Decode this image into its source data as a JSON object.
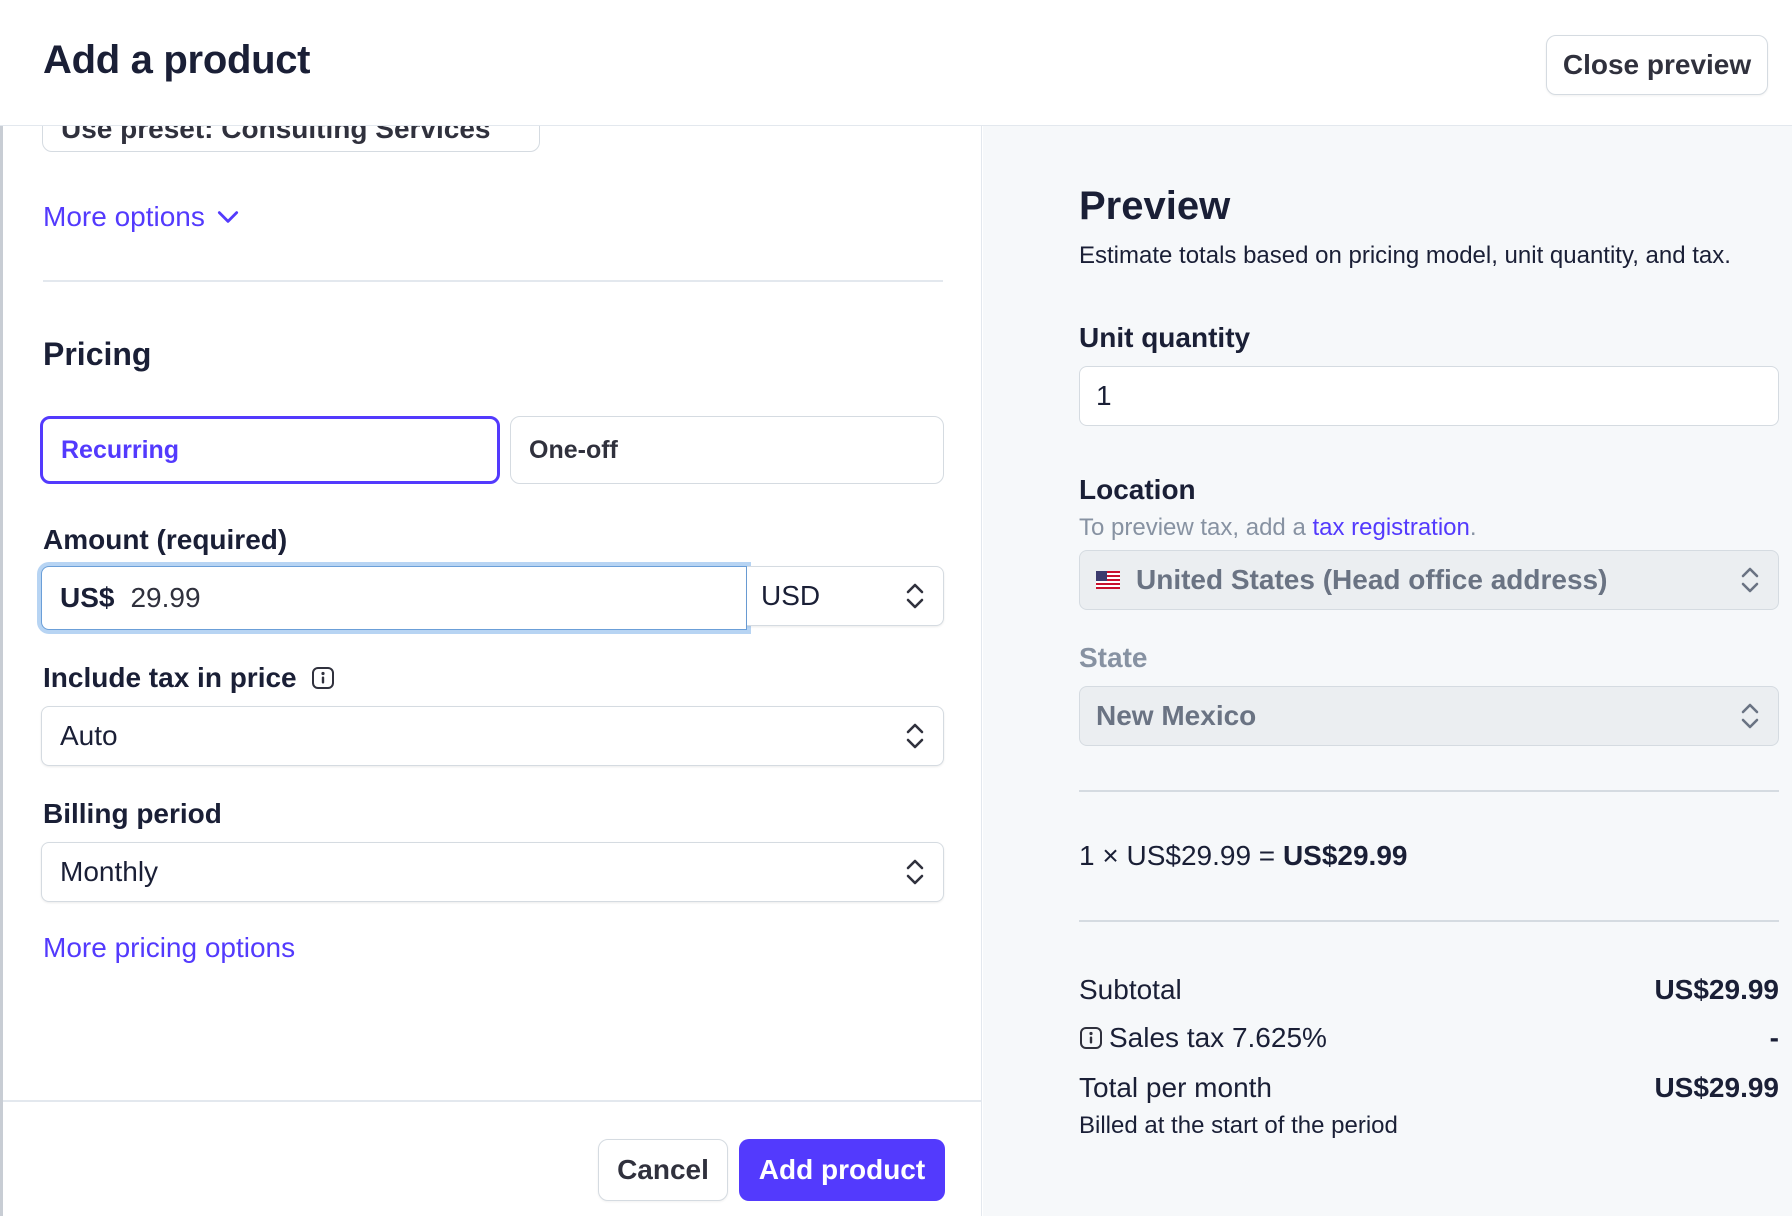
{
  "header": {
    "title": "Add a product",
    "close_preview_label": "Close preview"
  },
  "form": {
    "preset_label": "Use preset: Consulting Services",
    "more_options_label": "More options",
    "pricing_section_title": "Pricing",
    "pricing_types": {
      "recurring": "Recurring",
      "one_off": "One-off",
      "selected": "Recurring"
    },
    "amount": {
      "label": "Amount (required)",
      "prefix": "US$",
      "value": "29.99",
      "currency": "USD"
    },
    "include_tax": {
      "label": "Include tax in price",
      "value": "Auto"
    },
    "billing_period": {
      "label": "Billing period",
      "value": "Monthly"
    },
    "more_pricing_label": "More pricing options"
  },
  "footer": {
    "cancel_label": "Cancel",
    "add_label": "Add product"
  },
  "preview": {
    "title": "Preview",
    "subtitle": "Estimate totals based on pricing model, unit quantity, and tax.",
    "unit_quantity_label": "Unit quantity",
    "unit_quantity_value": "1",
    "location_label": "Location",
    "location_hint_prefix": "To preview tax, add a ",
    "location_hint_link": "tax registration",
    "location_hint_suffix": ".",
    "location_value": "United States (Head office address)",
    "state_label": "State",
    "state_value": "New Mexico",
    "calculation_prefix": "1 × US$29.99 = ",
    "calculation_total": "US$29.99",
    "subtotal_label": "Subtotal",
    "subtotal_value": "US$29.99",
    "sales_tax_label": "Sales tax 7.625%",
    "sales_tax_value": "-",
    "total_label": "Total per month",
    "total_value": "US$29.99",
    "billed_note": "Billed at the start of the period"
  },
  "colors": {
    "accent": "#533afd",
    "focus_ring": "#b7d4f3",
    "preview_bg": "#f6f8fa"
  }
}
